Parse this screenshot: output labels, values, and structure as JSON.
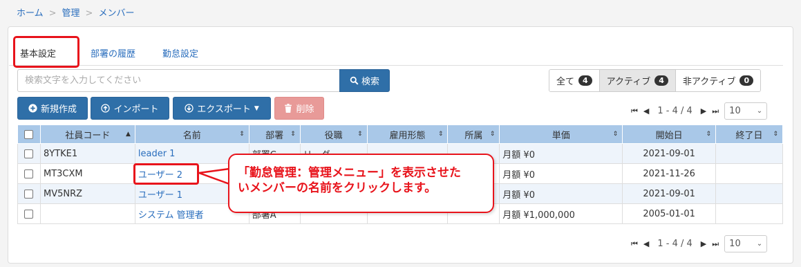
{
  "breadcrumb": [
    "ホーム",
    "管理",
    "メンバー"
  ],
  "breadcrumb_sep": ">",
  "tabs": [
    {
      "label": "基本設定",
      "active": true
    },
    {
      "label": "部署の履歴"
    },
    {
      "label": "勤怠設定"
    }
  ],
  "search": {
    "placeholder": "検索文字を入力してください",
    "button_label": "検索"
  },
  "filters": [
    {
      "label": "全て",
      "count": "4"
    },
    {
      "label": "アクティブ",
      "count": "4"
    },
    {
      "label": "非アクティブ",
      "count": "0"
    }
  ],
  "toolbar": {
    "new_label": "新規作成",
    "import_label": "インポート",
    "export_label": "エクスポート",
    "delete_label": "削除"
  },
  "pager": {
    "range": "1 - 4 / 4",
    "page_size": "10"
  },
  "table": {
    "headers": [
      "社員コード",
      "名前",
      "部署",
      "役職",
      "雇用形態",
      "所属",
      "単価",
      "開始日",
      "終了日"
    ],
    "rows": [
      {
        "code": "8YTKE1",
        "name": "leader 1",
        "dept": "部署C",
        "position": "リーダー",
        "employment": "",
        "affiliation": "",
        "price": "月額 ¥0",
        "start": "2021-09-01",
        "end": ""
      },
      {
        "code": "MT3CXM",
        "name": "ユーザー 2",
        "dept": "",
        "position": "",
        "employment": "",
        "affiliation": "",
        "price": "月額 ¥0",
        "start": "2021-11-26",
        "end": ""
      },
      {
        "code": "MV5NRZ",
        "name": "ユーザー 1",
        "dept": "",
        "position": "",
        "employment": "",
        "affiliation": "",
        "price": "月額 ¥0",
        "start": "2021-09-01",
        "end": ""
      },
      {
        "code": "",
        "name": "システム 管理者",
        "dept": "部署A",
        "position": "",
        "employment": "",
        "affiliation": "",
        "price": "月額 ¥1,000,000",
        "start": "2005-01-01",
        "end": ""
      }
    ]
  },
  "callout": {
    "line1": "「勤怠管理：管理メニュー」を表示させた",
    "line2": "いメンバーの名前をクリックします。"
  },
  "colors": {
    "accent": "#2f6fa8",
    "highlight": "#e8131b",
    "header": "#a9c8e8"
  }
}
